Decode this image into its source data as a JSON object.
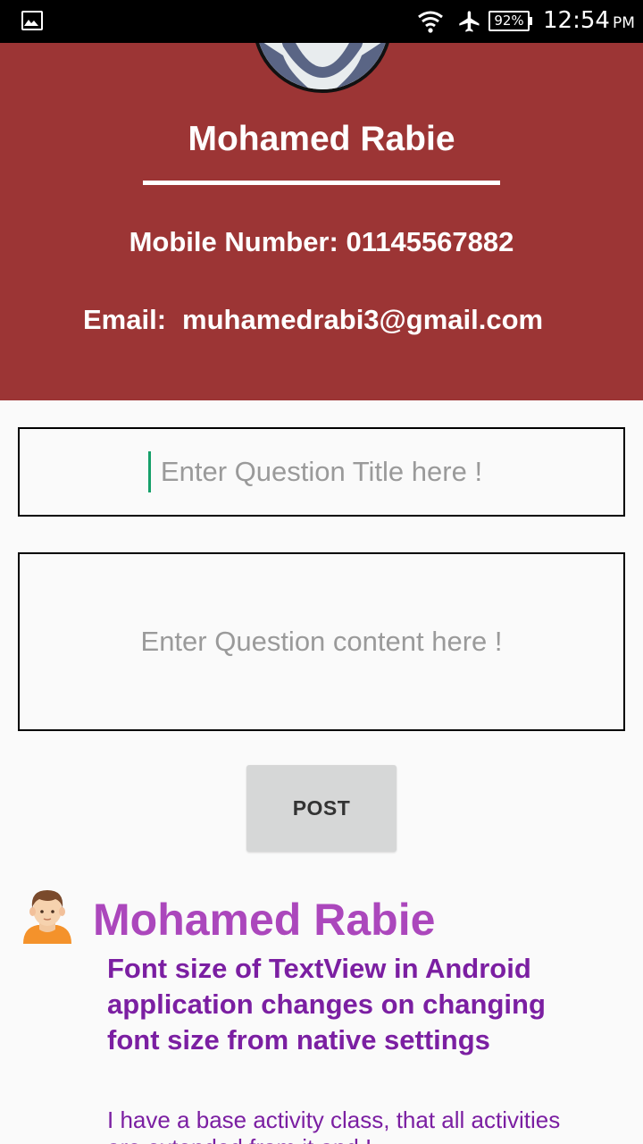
{
  "status_bar": {
    "battery": "92%",
    "time": "12:54",
    "ampm": "PM",
    "icons": [
      "gallery-icon",
      "wifi-icon",
      "airplane-mode-icon",
      "battery-icon"
    ]
  },
  "profile": {
    "name": "Mohamed Rabie",
    "mobile_label": "Mobile Number:",
    "mobile_value": "01145567882",
    "email_label": "Email:",
    "email_value": "muhamedrabi3@gmail.com",
    "header_color": "#9c3535"
  },
  "form": {
    "title_placeholder": "Enter Question Title here !",
    "title_value": "",
    "content_placeholder": "Enter Question content here !",
    "content_value": "",
    "post_label": "POST"
  },
  "posts": [
    {
      "author": "Mohamed Rabie",
      "title": "Font size of TextView in Android application changes on changing font size from native settings",
      "body": "I have a base activity class, that all activities are extended from it and I"
    }
  ],
  "colors": {
    "author_color": "#ab47bc",
    "title_color": "#7b1fa2",
    "cursor_color": "#16a06a"
  }
}
